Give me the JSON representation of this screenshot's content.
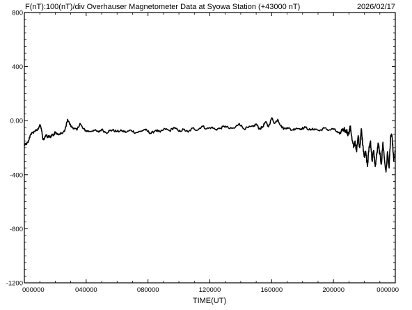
{
  "header": {
    "left_title": "F(nT):100(nT)/div  Overhauser Magnetometer Data at Syowa Station (+43000 nT)",
    "date": "2026/02/17"
  },
  "chart_data": {
    "type": "line",
    "title": "F(nT):100(nT)/div  Overhauser Magnetometer Data at Syowa Station (+43000 nT)",
    "xlabel": "TIME(UT)",
    "ylabel": "",
    "xlim": [
      0,
      24
    ],
    "ylim": [
      -1200,
      800
    ],
    "grid": false,
    "legend": "none",
    "line_color": "#000000",
    "x_tick_values": [
      0,
      4,
      8,
      12,
      16,
      20,
      24
    ],
    "x_tick_labels": [
      "000000",
      "040000",
      "080000",
      "120000",
      "160000",
      "200000",
      "000000"
    ],
    "y_tick_values": [
      800,
      400,
      0,
      -400,
      -800,
      -1200
    ],
    "y_tick_labels": [
      "800",
      "400",
      "0.00",
      "-400",
      "-800",
      "-1200"
    ],
    "series": [
      {
        "x": [
          0.0,
          0.1,
          0.25,
          0.4,
          0.55,
          0.7,
          0.85,
          1.0,
          1.1,
          1.2,
          1.3,
          1.4,
          1.5,
          1.6,
          1.7,
          1.8,
          1.9,
          2.0,
          2.2,
          2.4,
          2.6,
          2.8,
          3.0,
          3.2,
          3.4,
          3.6,
          3.8,
          4.0,
          4.2,
          4.5,
          4.8,
          5.0,
          5.3,
          5.5,
          5.7,
          6.0,
          6.3,
          6.6,
          6.9,
          7.2,
          7.5,
          7.8,
          8.0,
          8.2,
          8.5,
          8.8,
          9.1,
          9.4,
          9.7,
          10.0,
          10.3,
          10.6,
          10.9,
          11.2,
          11.5,
          11.8,
          12.1,
          12.4,
          12.7,
          13.0,
          13.3,
          13.6,
          13.9,
          14.2,
          14.5,
          14.8,
          15.0,
          15.2,
          15.4,
          15.6,
          15.8,
          16.0,
          16.2,
          16.4,
          16.6,
          16.8,
          17.0,
          17.3,
          17.6,
          17.9,
          18.2,
          18.5,
          18.8,
          19.1,
          19.4,
          19.7,
          20.0,
          20.2,
          20.4,
          20.6,
          20.8,
          21.0,
          21.1,
          21.2,
          21.3,
          21.4,
          21.5,
          21.6,
          21.7,
          21.8,
          21.9,
          22.0,
          22.1,
          22.2,
          22.3,
          22.4,
          22.5,
          22.6,
          22.7,
          22.8,
          22.9,
          23.0,
          23.1,
          23.2,
          23.3,
          23.4,
          23.5,
          23.6,
          23.7,
          23.8,
          23.9,
          24.0
        ],
        "values": [
          -180,
          -175,
          -160,
          -100,
          -90,
          -75,
          -70,
          -30,
          -60,
          -140,
          -130,
          -105,
          -120,
          -110,
          -125,
          -100,
          -110,
          -85,
          -105,
          -95,
          -80,
          10,
          -40,
          -55,
          -70,
          -20,
          -60,
          -75,
          -80,
          -70,
          -85,
          -65,
          -90,
          -75,
          -70,
          -80,
          -75,
          -85,
          -70,
          -90,
          -80,
          -65,
          -80,
          -95,
          -70,
          -85,
          -60,
          -75,
          -50,
          -80,
          -65,
          -85,
          -55,
          -70,
          -40,
          -60,
          -50,
          -65,
          -55,
          -40,
          -60,
          -55,
          -20,
          -60,
          -50,
          -45,
          -25,
          -60,
          -50,
          -10,
          -45,
          20,
          -20,
          10,
          -40,
          -60,
          -50,
          -70,
          -55,
          -60,
          -50,
          -70,
          -60,
          -75,
          -55,
          -70,
          -60,
          -80,
          -100,
          -60,
          -70,
          -100,
          -40,
          -140,
          -200,
          -150,
          -230,
          -110,
          -200,
          -60,
          -180,
          -260,
          -240,
          -340,
          -200,
          -150,
          -300,
          -220,
          -340,
          -250,
          -170,
          -250,
          -320,
          -160,
          -290,
          -380,
          -230,
          -350,
          -110,
          -130,
          -300,
          -230
        ]
      }
    ]
  }
}
